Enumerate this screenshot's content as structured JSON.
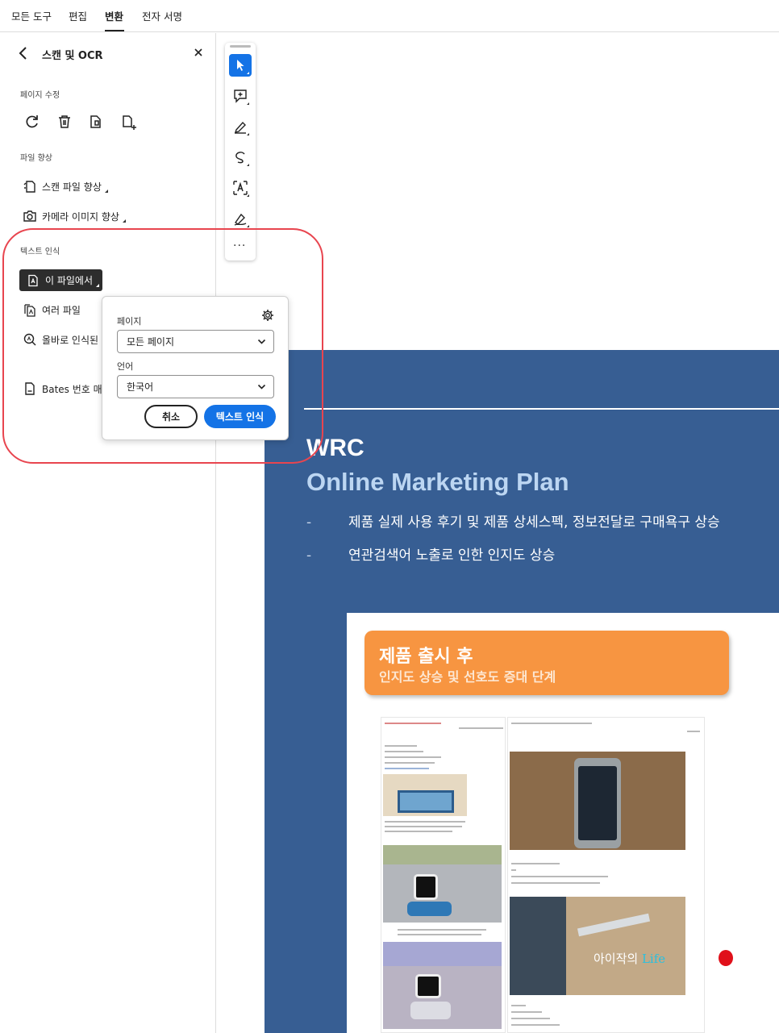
{
  "menu": {
    "tabs": [
      {
        "label": "모든 도구"
      },
      {
        "label": "편집"
      },
      {
        "label": "변환"
      },
      {
        "label": "전자 서명"
      }
    ],
    "active_tab": "변환"
  },
  "panel": {
    "title": "스캔 및 OCR",
    "section_page_edit": "페이지 수정",
    "page_tools": [
      "rotate-icon",
      "delete-icon",
      "extract-page-icon",
      "insert-page-icon"
    ],
    "section_file_enhance": "파일 향상",
    "enhance_scan": "스캔 파일 향상",
    "enhance_camera": "카메라 이미지 향상",
    "section_text_recognition": "텍스트 인식",
    "in_this_file": "이 파일에서",
    "multiple_files": "여러 파일",
    "correct_recognized": "올바로 인식된",
    "bates": "Bates 번호 매"
  },
  "toolbar": {
    "tools": [
      "select-icon",
      "add-comment-icon",
      "highlight-icon",
      "draw-icon",
      "text-recognition-icon",
      "sign-icon"
    ],
    "more": "···"
  },
  "popup": {
    "page_label": "페이지",
    "page_value": "모든 페이지",
    "language_label": "언어",
    "language_value": "한국어",
    "cancel_label": "취소",
    "ocr_label": "텍스트 인식"
  },
  "document": {
    "title_line1": "WRC",
    "title_line2": "Online Marketing Plan",
    "bullet_dash": "-",
    "bullet1": "제품 실제 사용 후기 및 제품 상세스펙, 정보전달로 구매욕구 상승",
    "bullet2": "연관검색어 노출로 인한 인지도 상승",
    "banner_title": "제품 출시 후",
    "banner_subtitle": "인지도 상승 및 선호도 증대 단계",
    "watermark_prefix": "아이작의 ",
    "watermark_life": "Life"
  },
  "colors": {
    "accent": "#1473e6",
    "doc_background": "#375e93",
    "doc_subtitle": "#bcd6f2",
    "banner": "#f79541",
    "highlight_outline": "#e8454f"
  }
}
